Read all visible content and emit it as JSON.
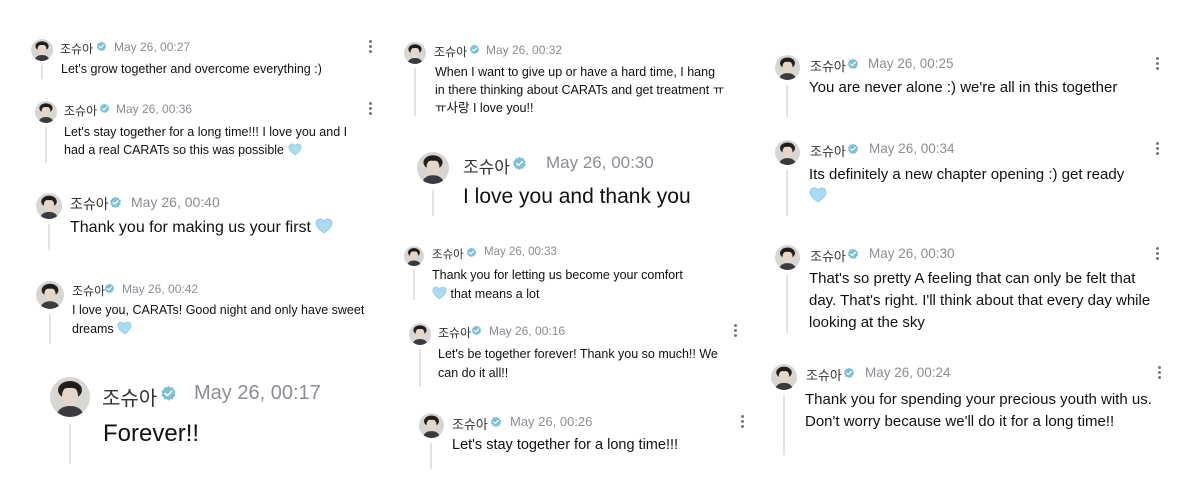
{
  "author": {
    "name": "조슈아",
    "verified_icon": "verified-badge-icon",
    "avatar_icon": "avatar-photo"
  },
  "colors": {
    "badge": "#7dc0d6",
    "heart": "#a9dcf2",
    "time": "#8a8d93",
    "line": "#e2e3e6"
  },
  "columns": [
    {
      "posts": [
        {
          "time": "May 26, 00:27",
          "text": "Let's grow together and overcome everything :)"
        },
        {
          "time": "May 26, 00:36",
          "text": "Let's stay together for a long time!!! I love you and I had a real CARATs so this was possible",
          "heart": true
        },
        {
          "time": "May 26, 00:40",
          "text": "Thank you for making us your first",
          "heart": true
        },
        {
          "time": "May 26, 00:42",
          "text": "I love you, CARATs! Good night and only have sweet dreams",
          "heart": true
        },
        {
          "time": "May 26, 00:17",
          "text": "Forever!!"
        }
      ]
    },
    {
      "posts": [
        {
          "time": "May 26, 00:32",
          "text": "When I want to give up or have a hard time, I hang in there thinking about CARATs and get treatment ㅠㅠ사랑 I love you!!"
        },
        {
          "time": "May 26, 00:30",
          "text": "I love you and thank you"
        },
        {
          "time": "May 26, 00:33",
          "text_a": "Thank you for letting us become your comfort",
          "text_b": "that means a lot",
          "heart": true
        },
        {
          "time": "May 26, 00:16",
          "text": "Let's be together forever! Thank you so much!! We can do it all!!"
        },
        {
          "time": "May 26, 00:26",
          "text": "Let's stay together for a long time!!!"
        }
      ]
    },
    {
      "posts": [
        {
          "time": "May 26, 00:25",
          "text": "You are never alone :) we're all in this together"
        },
        {
          "time": "May 26, 00:34",
          "text": "Its definitely a new chapter opening :) get ready",
          "heart": true
        },
        {
          "time": "May 26, 00:30",
          "text": "That's so pretty A feeling that can only be felt that day. That's right. I'll think about that every day while looking at the sky"
        },
        {
          "time": "May 26, 00:24",
          "text": "Thank you for spending your precious youth with us. Don't worry because we'll do it for a long time!!"
        }
      ]
    }
  ]
}
